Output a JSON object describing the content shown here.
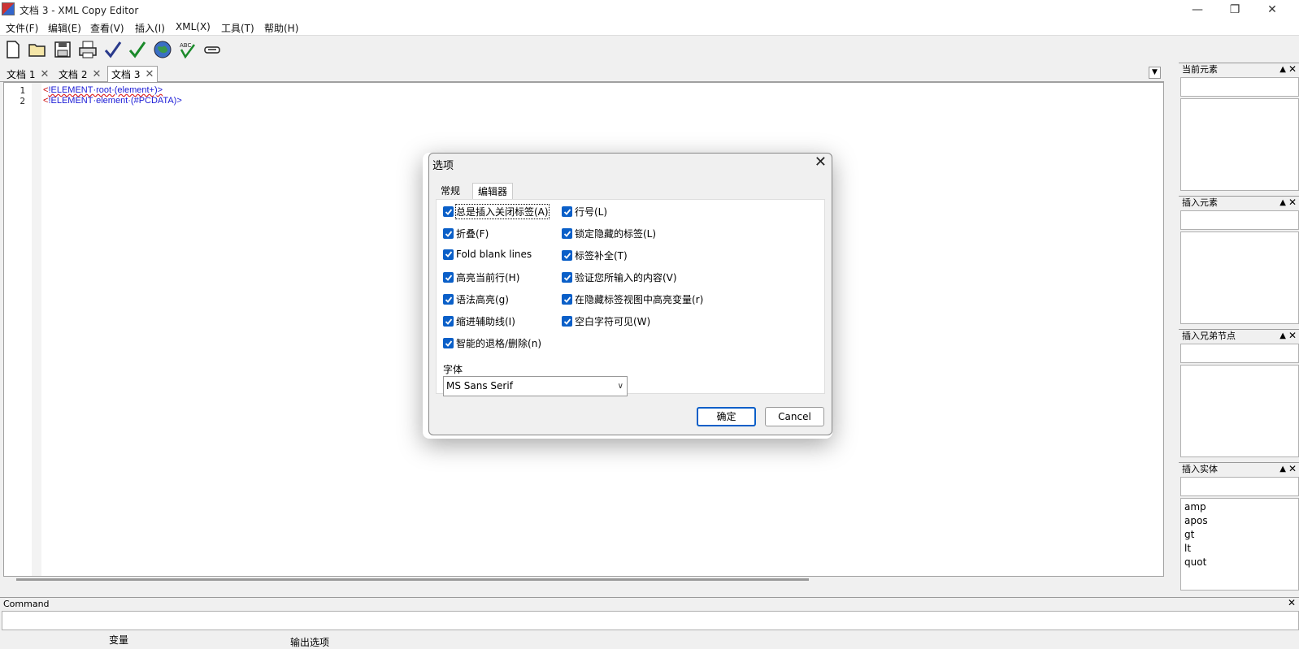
{
  "window": {
    "title": "文档 3 - XML Copy Editor"
  },
  "menu": [
    "文件(F)",
    "编辑(E)",
    "查看(V)",
    "插入(I)",
    "XML(X)",
    "工具(T)",
    "帮助(H)"
  ],
  "tabs": [
    {
      "label": "文档 1"
    },
    {
      "label": "文档 2"
    },
    {
      "label": "文档 3"
    }
  ],
  "editor": {
    "lines": [
      {
        "num": "1",
        "prefix": "<",
        "rest": "!ELEMENT·root·(element+)>"
      },
      {
        "num": "2",
        "prefix": "<",
        "rest": "!ELEMENT·element·(#PCDATA)>"
      }
    ]
  },
  "panels": {
    "current_element": {
      "title": "当前元素"
    },
    "insert_element": {
      "title": "插入元素"
    },
    "insert_sibling": {
      "title": "插入兄弟节点"
    },
    "insert_entity": {
      "title": "插入实体",
      "items": [
        "amp",
        "apos",
        "gt",
        "lt",
        "quot"
      ]
    }
  },
  "command": {
    "title": "Command"
  },
  "bottom": {
    "vars_label": "变量",
    "output_label": "输出选项"
  },
  "dialog": {
    "title": "选项",
    "tabs": [
      "常规",
      "编辑器"
    ],
    "left_options": [
      "总是插入关闭标签(A)",
      "折叠(F)",
      "Fold blank lines",
      "高亮当前行(H)",
      "语法高亮(g)",
      "缩进辅助线(I)",
      "智能的退格/删除(n)"
    ],
    "right_options": [
      "行号(L)",
      "锁定隐藏的标签(L)",
      "标签补全(T)",
      "验证您所输入的内容(V)",
      "在隐藏标签视图中高亮变量(r)",
      "空白字符可见(W)"
    ],
    "font_label": "字体",
    "font_value": "MS Sans Serif",
    "ok_label": "确定",
    "cancel_label": "Cancel"
  }
}
